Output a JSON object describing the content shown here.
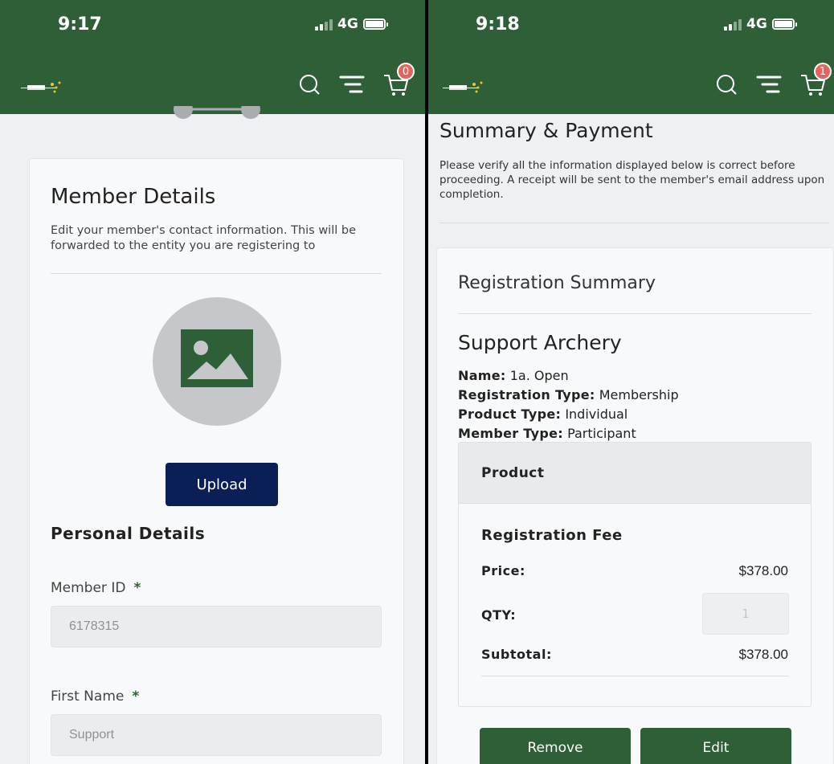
{
  "left": {
    "status_time": "9:17",
    "network": "4G",
    "cart_count": "0",
    "title": "Member Details",
    "subtitle": "Edit your member's contact information. This will be forwarded to the entity you are registering to",
    "upload_label": "Upload",
    "personal_heading": "Personal Details",
    "member_id_label": "Member ID",
    "member_id_value": "6178315",
    "first_name_label": "First Name",
    "first_name_value": "Support",
    "required_mark": "*"
  },
  "right": {
    "status_time": "9:18",
    "network": "4G",
    "cart_count": "1",
    "title": "Summary & Payment",
    "subtitle": "Please verify all the information displayed below is correct before proceeding.  A receipt will be sent to the member's email address upon completion.",
    "reg_summary_heading": "Registration Summary",
    "org_name": "Support Archery",
    "details": [
      {
        "label": "Name:",
        "value": "1a. Open"
      },
      {
        "label": "Registration Type:",
        "value": "Membership"
      },
      {
        "label": "Product Type:",
        "value": "Individual"
      },
      {
        "label": "Member Type:",
        "value": "Participant"
      }
    ],
    "product_header": "Product",
    "fee_title": "Registration Fee",
    "price_label": "Price:",
    "price_value": "$378.00",
    "qty_label": "QTY:",
    "qty_value": "1",
    "subtotal_label": "Subtotal:",
    "subtotal_value": "$378.00",
    "remove_label": "Remove",
    "edit_label": "Edit"
  },
  "colors": {
    "brand_green": "#2f5f37",
    "upload_blue": "#0b1f57",
    "badge_red": "#e5625f"
  }
}
